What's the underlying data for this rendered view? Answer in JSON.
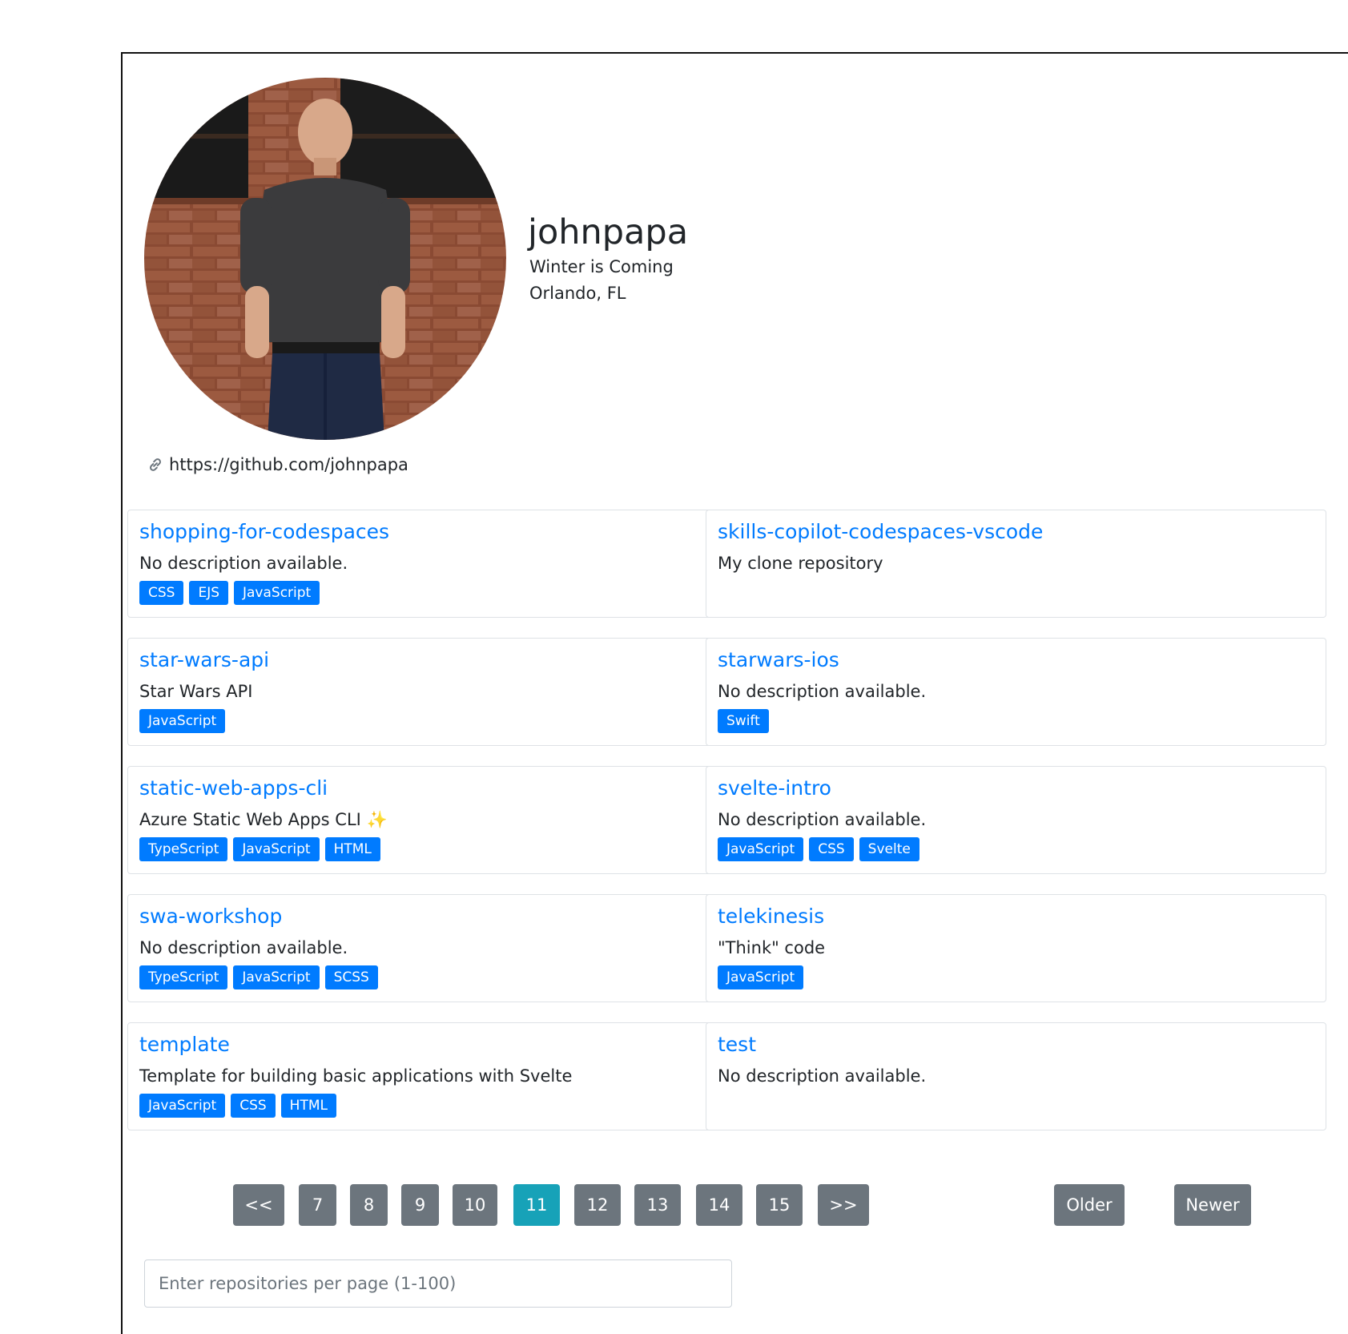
{
  "profile": {
    "name": "johnpapa",
    "bio": "Winter is Coming",
    "location": "Orlando, FL",
    "url": "https://github.com/johnpapa",
    "link_icon": "link-icon"
  },
  "repos": [
    {
      "name": "shopping-for-codespaces",
      "description": "No description available.",
      "tags": [
        "CSS",
        "EJS",
        "JavaScript"
      ]
    },
    {
      "name": "skills-copilot-codespaces-vscode",
      "description": "My clone repository",
      "tags": []
    },
    {
      "name": "star-wars-api",
      "description": "Star Wars API",
      "tags": [
        "JavaScript"
      ]
    },
    {
      "name": "starwars-ios",
      "description": "No description available.",
      "tags": [
        "Swift"
      ]
    },
    {
      "name": "static-web-apps-cli",
      "description": "Azure Static Web Apps CLI ✨",
      "tags": [
        "TypeScript",
        "JavaScript",
        "HTML"
      ]
    },
    {
      "name": "svelte-intro",
      "description": "No description available.",
      "tags": [
        "JavaScript",
        "CSS",
        "Svelte"
      ]
    },
    {
      "name": "swa-workshop",
      "description": "No description available.",
      "tags": [
        "TypeScript",
        "JavaScript",
        "SCSS"
      ]
    },
    {
      "name": "telekinesis",
      "description": "\"Think\" code",
      "tags": [
        "JavaScript"
      ]
    },
    {
      "name": "template",
      "description": "Template for building basic applications with Svelte",
      "tags": [
        "JavaScript",
        "CSS",
        "HTML"
      ]
    },
    {
      "name": "test",
      "description": "No description available.",
      "tags": []
    }
  ],
  "pagination": {
    "first": "<<",
    "pages": [
      "7",
      "8",
      "9",
      "10",
      "11",
      "12",
      "13",
      "14",
      "15"
    ],
    "active_page": "11",
    "last": ">>",
    "older": "Older",
    "newer": "Newer"
  },
  "per_page_input": {
    "placeholder": "Enter repositories per page (1-100)",
    "value": ""
  },
  "colors": {
    "accent": "#007bff",
    "button": "#6c757d",
    "active_button": "#17a2b8"
  }
}
